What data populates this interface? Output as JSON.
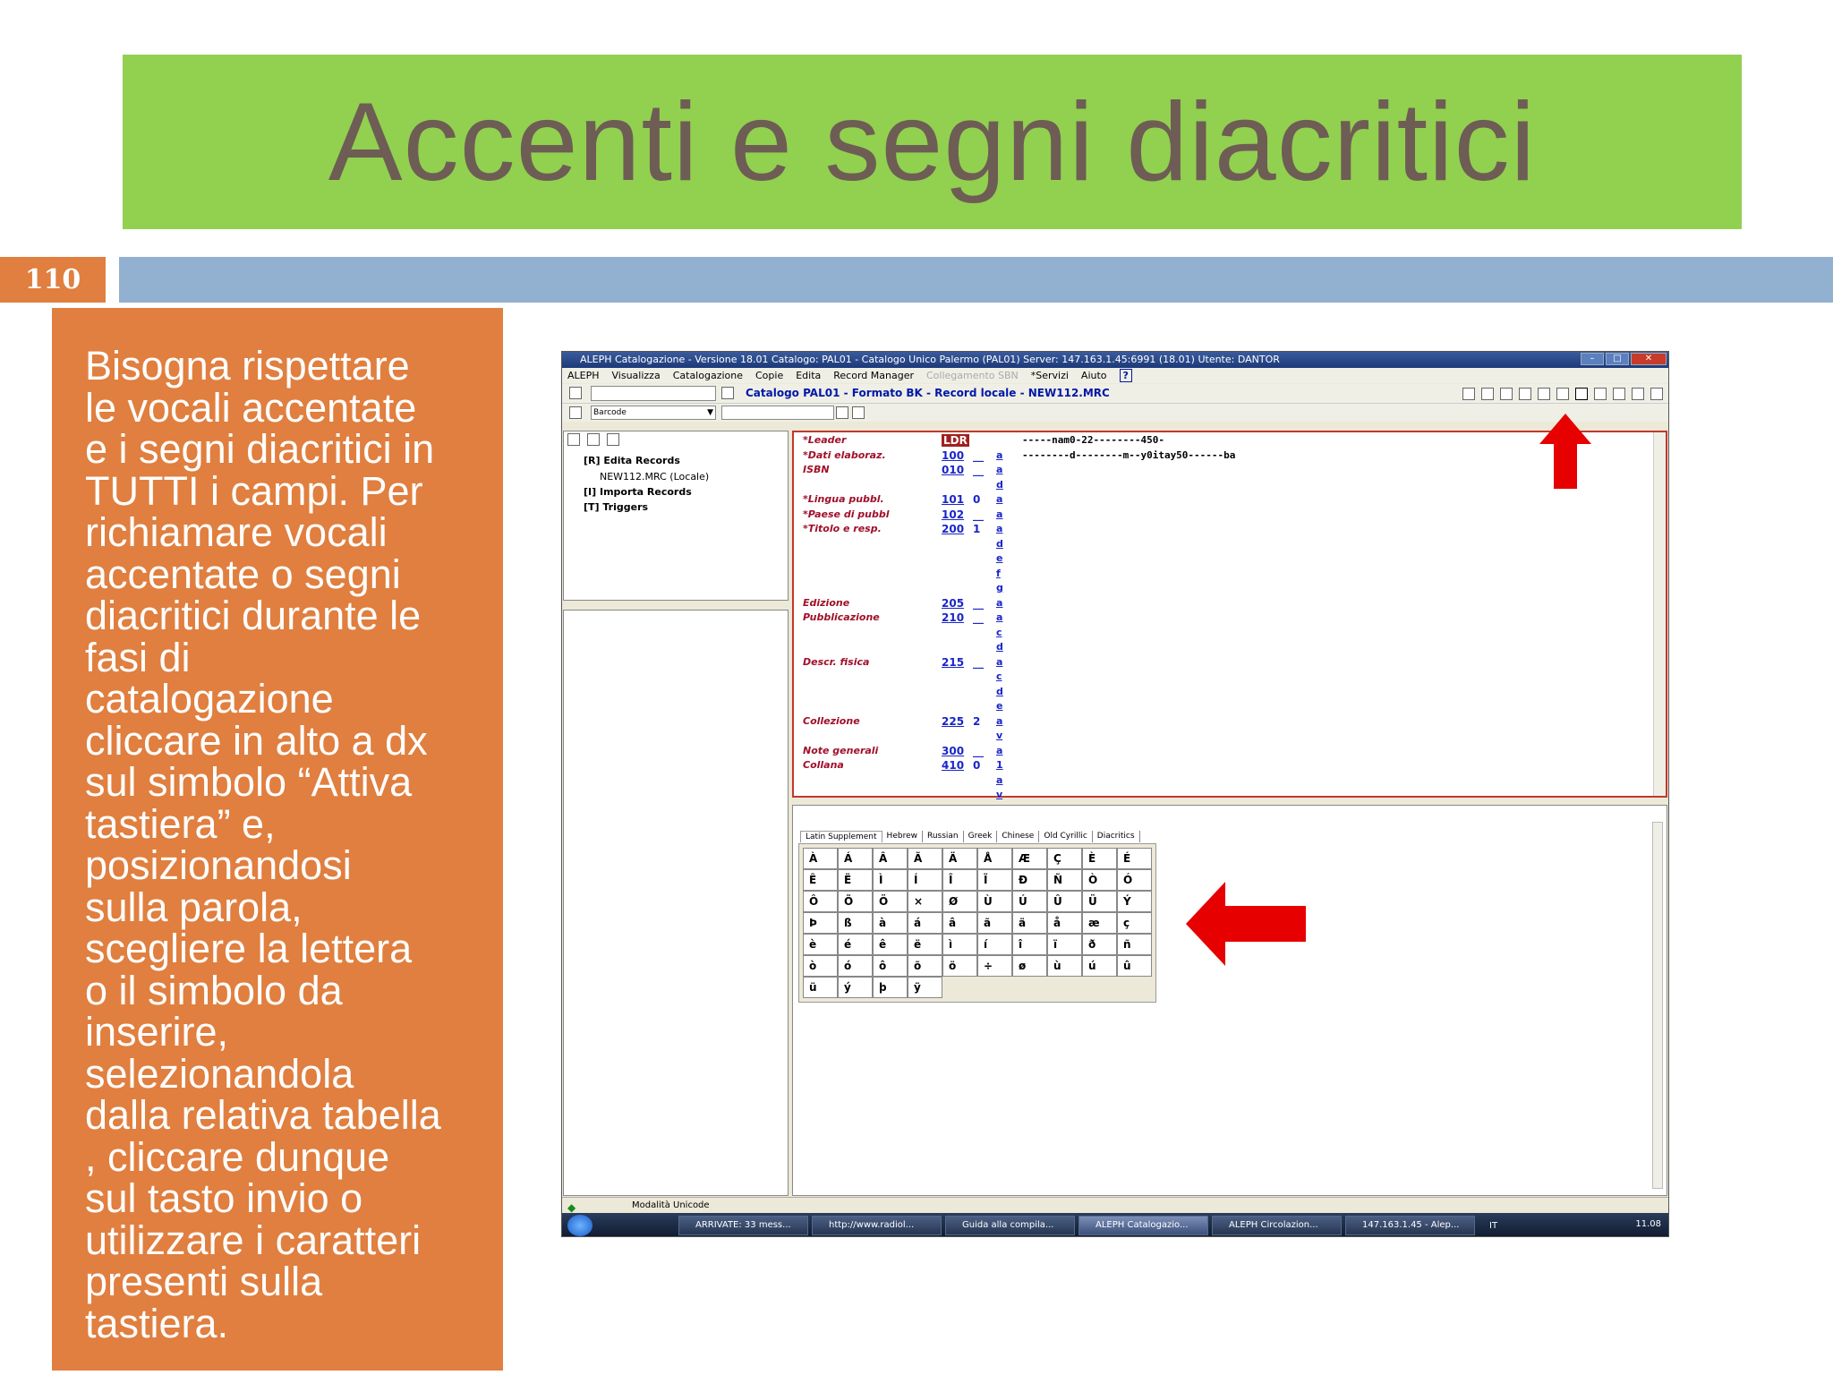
{
  "slide": {
    "title": "Accenti e segni diacritici",
    "page_number": "110",
    "body": "Bisogna rispettare\nle vocali accentate\ne i segni diacritici in\nTUTTI i campi. Per\nrichiamare vocali\naccentate o segni\ndiacritici durante le\nfasi di\ncatalogazione\ncliccare in alto a dx\nsul simbolo “Attiva\ntastiera” e,\nposizionandosi\nsulla parola,\nscegliere la lettera\no il simbolo da\ninserire,\nselezionandola\ndalla relativa tabella\n, cliccare dunque\nsul tasto invio o\nutilizzare i caratteri\npresenti sulla\ntastiera."
  },
  "colors": {
    "title_bar": "#92d050",
    "accent_orange": "#e07f3f",
    "blue_bar": "#92b0cf",
    "arrow_red": "#e60000"
  },
  "app": {
    "title": "ALEPH Catalogazione - Versione 18.01  Catalogo:  PAL01 - Catalogo Unico Palermo (PAL01)  Server:  147.163.1.45:6991 (18.01)  Utente:  DANTOR",
    "menu": [
      "ALEPH",
      "Visualizza",
      "Catalogazione",
      "Copie",
      "Edita",
      "Record Manager",
      "Collegamento SBN",
      "*Servizi",
      "Aiuto"
    ],
    "catalog_label": "Catalogo PAL01 - Formato BK - Record locale - NEW112.MRC",
    "barcode_select": "Barcode",
    "tree": {
      "edit_records": "[R] Edita Records",
      "record_file": "NEW112.MRC (Locale)",
      "import_records": "[I] Importa Records",
      "triggers": "[T] Triggers"
    },
    "record_fields": [
      {
        "name": "*Leader",
        "tag": "LDR",
        "ind": "",
        "sub": "",
        "value": "-----nam0-22--------450-"
      },
      {
        "name": "*Dati elaboraz.",
        "tag": "100",
        "ind": "__",
        "sub": "a",
        "value": "--------d--------m--y0itay50------ba"
      },
      {
        "name": "ISBN",
        "tag": "010",
        "ind": "__",
        "sub": "a",
        "value": ""
      },
      {
        "name": "",
        "tag": "",
        "ind": "",
        "sub": "d",
        "value": ""
      },
      {
        "name": "*Lingua pubbl.",
        "tag": "101",
        "ind": "0",
        "sub": "a",
        "value": ""
      },
      {
        "name": "*Paese di pubbl",
        "tag": "102",
        "ind": "__",
        "sub": "a",
        "value": ""
      },
      {
        "name": "*Titolo e resp.",
        "tag": "200",
        "ind": "1",
        "sub": "a",
        "value": ""
      },
      {
        "name": "",
        "tag": "",
        "ind": "",
        "sub": "d",
        "value": ""
      },
      {
        "name": "",
        "tag": "",
        "ind": "",
        "sub": "e",
        "value": ""
      },
      {
        "name": "",
        "tag": "",
        "ind": "",
        "sub": "f",
        "value": ""
      },
      {
        "name": "",
        "tag": "",
        "ind": "",
        "sub": "g",
        "value": ""
      },
      {
        "name": "Edizione",
        "tag": "205",
        "ind": "__",
        "sub": "a",
        "value": ""
      },
      {
        "name": "Pubblicazione",
        "tag": "210",
        "ind": "__",
        "sub": "a",
        "value": ""
      },
      {
        "name": "",
        "tag": "",
        "ind": "",
        "sub": "c",
        "value": ""
      },
      {
        "name": "",
        "tag": "",
        "ind": "",
        "sub": "d",
        "value": ""
      },
      {
        "name": "Descr. fisica",
        "tag": "215",
        "ind": "__",
        "sub": "a",
        "value": ""
      },
      {
        "name": "",
        "tag": "",
        "ind": "",
        "sub": "c",
        "value": ""
      },
      {
        "name": "",
        "tag": "",
        "ind": "",
        "sub": "d",
        "value": ""
      },
      {
        "name": "",
        "tag": "",
        "ind": "",
        "sub": "e",
        "value": ""
      },
      {
        "name": "Collezione",
        "tag": "225",
        "ind": "2",
        "sub": "a",
        "value": ""
      },
      {
        "name": "",
        "tag": "",
        "ind": "",
        "sub": "v",
        "value": ""
      },
      {
        "name": "Note generali",
        "tag": "300",
        "ind": "__",
        "sub": "a",
        "value": ""
      },
      {
        "name": "Collana",
        "tag": "410",
        "ind": "0",
        "sub": "1",
        "value": ""
      },
      {
        "name": "",
        "tag": "",
        "ind": "",
        "sub": "a",
        "value": ""
      },
      {
        "name": "",
        "tag": "",
        "ind": "",
        "sub": "v",
        "value": ""
      }
    ],
    "keyboard_tabs": [
      "Latin Supplement",
      "Hebrew",
      "Russian",
      "Greek",
      "Chinese",
      "Old Cyrillic",
      "Diacritics"
    ],
    "keyboard_rows": [
      [
        "À",
        "Á",
        "Â",
        "Ã",
        "Ä",
        "Å",
        "Æ",
        "Ç",
        "È",
        "É"
      ],
      [
        "Ê",
        "Ë",
        "Ì",
        "Í",
        "Î",
        "Ï",
        "Ð",
        "Ñ",
        "Ò",
        "Ó"
      ],
      [
        "Ô",
        "Õ",
        "Ö",
        "×",
        "Ø",
        "Ù",
        "Ú",
        "Û",
        "Ü",
        "Ý"
      ],
      [
        "Þ",
        "ß",
        "à",
        "á",
        "â",
        "ã",
        "ä",
        "å",
        "æ",
        "ç"
      ],
      [
        "è",
        "é",
        "ê",
        "ë",
        "ì",
        "í",
        "î",
        "ï",
        "ð",
        "ñ"
      ],
      [
        "ò",
        "ó",
        "ô",
        "õ",
        "ö",
        "÷",
        "ø",
        "ù",
        "ú",
        "û"
      ],
      [
        "ü",
        "ý",
        "þ",
        "ÿ"
      ]
    ],
    "status_text": "Modalità Unicode",
    "taskbar_items": [
      "ARRIVATE: 33 mess...",
      "http://www.radiol...",
      "Guida alla compila...",
      "ALEPH Catalogazio...",
      "ALEPH Circolazion...",
      "147.163.1.45 - Alep..."
    ],
    "active_task": 3,
    "tray_lang": "IT",
    "clock": "11.08"
  }
}
